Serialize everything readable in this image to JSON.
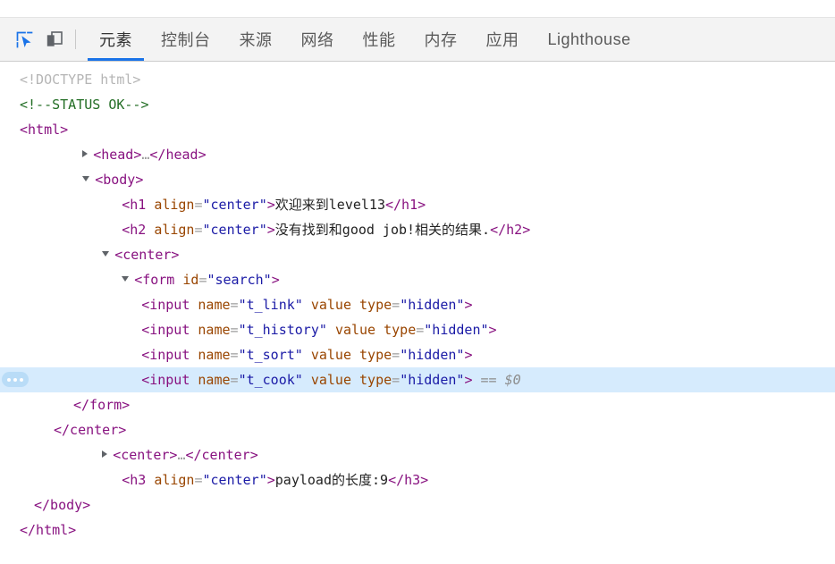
{
  "toolbar": {
    "inspect_icon": "inspect-cursor-icon",
    "device_icon": "device-toolbar-icon",
    "tabs": [
      {
        "label": "元素",
        "active": true
      },
      {
        "label": "控制台",
        "active": false
      },
      {
        "label": "来源",
        "active": false
      },
      {
        "label": "网络",
        "active": false
      },
      {
        "label": "性能",
        "active": false
      },
      {
        "label": "内存",
        "active": false
      },
      {
        "label": "应用",
        "active": false
      },
      {
        "label": "Lighthouse",
        "active": false
      }
    ]
  },
  "colors": {
    "accent": "#1a73e8",
    "selected_row": "#d6ebfd",
    "tag": "#881280",
    "attr_name": "#994500",
    "attr_value": "#1a1aa6",
    "comment": "#236e25",
    "doctype": "#b5b5b5",
    "toolbar_bg": "#f3f3f3"
  },
  "dom": {
    "doctype": "<!DOCTYPE html>",
    "comment": "<!--STATUS OK-->",
    "html_open": "<html>",
    "head_collapsed": {
      "open": "<head>",
      "ellipsis": "…",
      "close": "</head>"
    },
    "body_open": "<body>",
    "h1": {
      "tag_open_start": "<h1 ",
      "attr": "align",
      "eq": "=",
      "value": "\"center\"",
      "gt": ">",
      "text": "欢迎来到level13",
      "close": "</h1>"
    },
    "h2": {
      "tag_open_start": "<h2 ",
      "attr": "align",
      "eq": "=",
      "value": "\"center\"",
      "gt": ">",
      "text": "没有找到和good job!相关的结果.",
      "close": "</h2>"
    },
    "center_open": "<center>",
    "form": {
      "tag_open_start": "<form ",
      "attr": "id",
      "eq": "=",
      "value": "\"search\"",
      "gt": ">"
    },
    "inputs": [
      {
        "tag_open_start": "<input ",
        "attr_name": "name",
        "eq": "=",
        "name_value": "\"t_link\"",
        "attr_value": "value",
        "attr_type": "type",
        "type_value": "\"hidden\"",
        "gt": ">",
        "selected": false,
        "selector_ref": ""
      },
      {
        "tag_open_start": "<input ",
        "attr_name": "name",
        "eq": "=",
        "name_value": "\"t_history\"",
        "attr_value": "value",
        "attr_type": "type",
        "type_value": "\"hidden\"",
        "gt": ">",
        "selected": false,
        "selector_ref": ""
      },
      {
        "tag_open_start": "<input ",
        "attr_name": "name",
        "eq": "=",
        "name_value": "\"t_sort\"",
        "attr_value": "value",
        "attr_type": "type",
        "type_value": "\"hidden\"",
        "gt": ">",
        "selected": false,
        "selector_ref": ""
      },
      {
        "tag_open_start": "<input ",
        "attr_name": "name",
        "eq": "=",
        "name_value": "\"t_cook\"",
        "attr_value": "value",
        "attr_type": "type",
        "type_value": "\"hidden\"",
        "gt": ">",
        "selected": true,
        "selector_ref": "== $0"
      }
    ],
    "form_close": "</form>",
    "center_close": "</center>",
    "center_collapsed": {
      "open": "<center>",
      "ellipsis": "…",
      "close": "</center>"
    },
    "h3": {
      "tag_open_start": "<h3 ",
      "attr": "align",
      "eq": "=",
      "value": "\"center\"",
      "gt": ">",
      "text": "payload的长度:9",
      "close": "</h3>"
    },
    "body_close": "</body>",
    "html_close": "</html>"
  }
}
